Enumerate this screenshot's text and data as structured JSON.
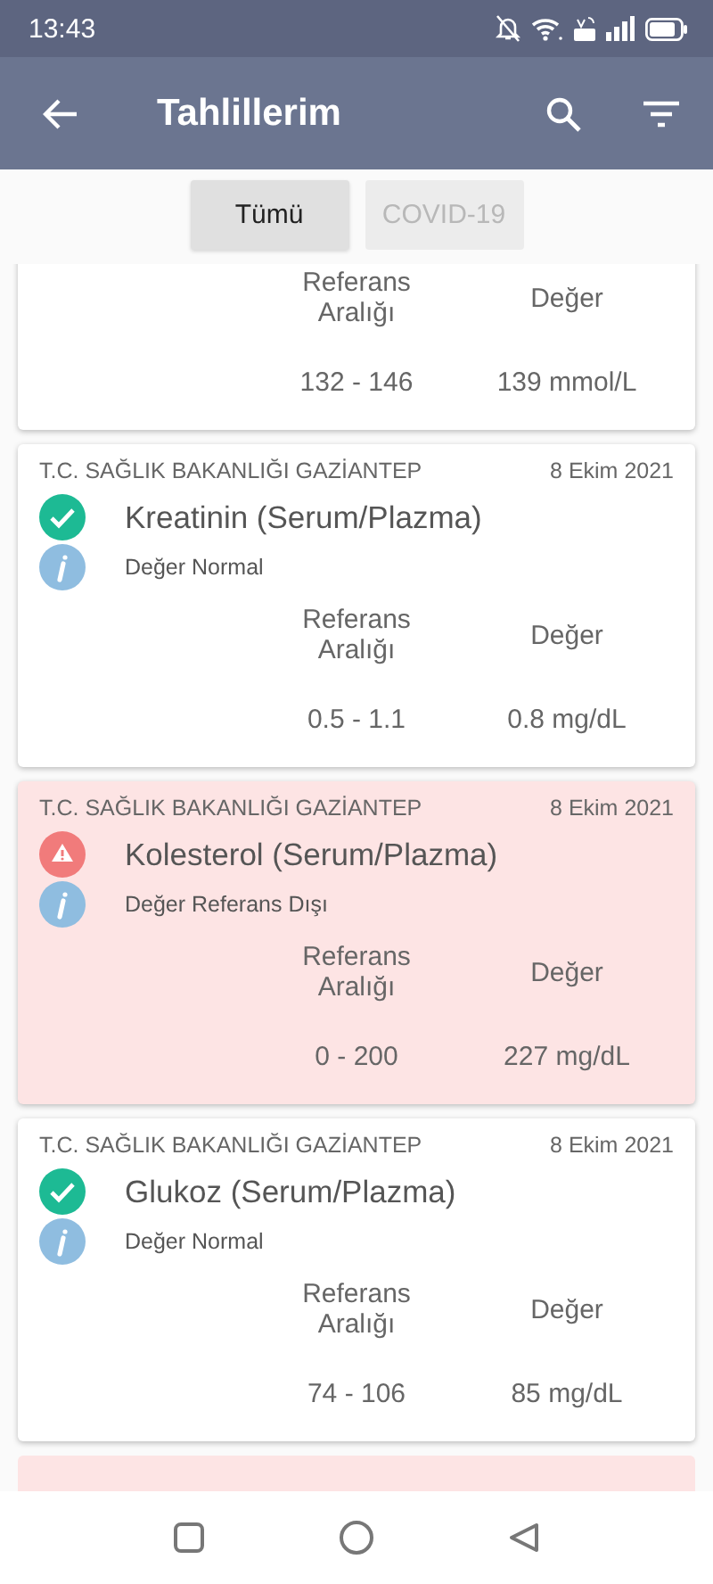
{
  "status_bar": {
    "time": "13:43"
  },
  "app_bar": {
    "title": "Tahlillerim"
  },
  "tabs": [
    {
      "label": "Tümü",
      "selected": true
    },
    {
      "label": "COVID-19",
      "selected": false
    }
  ],
  "results": [
    {
      "out_of_range": false,
      "range_label": "Referans Aralığı",
      "value_label": "Değer",
      "range": "132 - 146",
      "value": "139 mmol/L"
    },
    {
      "out_of_range": false,
      "institution": "T.C. SAĞLIK BAKANLIĞI GAZİANTEP",
      "date": "8 Ekim 2021",
      "test": "Kreatinin (Serum/Plazma)",
      "note": "Değer Normal",
      "range_label": "Referans Aralığı",
      "value_label": "Değer",
      "range": "0.5 - 1.1",
      "value": "0.8 mg/dL"
    },
    {
      "out_of_range": true,
      "institution": "T.C. SAĞLIK BAKANLIĞI GAZİANTEP",
      "date": "8 Ekim 2021",
      "test": "Kolesterol (Serum/Plazma)",
      "note": "Değer Referans Dışı",
      "range_label": "Referans Aralığı",
      "value_label": "Değer",
      "range": "0 - 200",
      "value": "227 mg/dL"
    },
    {
      "out_of_range": false,
      "institution": "T.C. SAĞLIK BAKANLIĞI GAZİANTEP",
      "date": "8 Ekim 2021",
      "test": "Glukoz (Serum/Plazma)",
      "note": "Değer Normal",
      "range_label": "Referans Aralığı",
      "value_label": "Değer",
      "range": "74 - 106",
      "value": "85 mg/dL"
    },
    {
      "out_of_range": true
    }
  ]
}
